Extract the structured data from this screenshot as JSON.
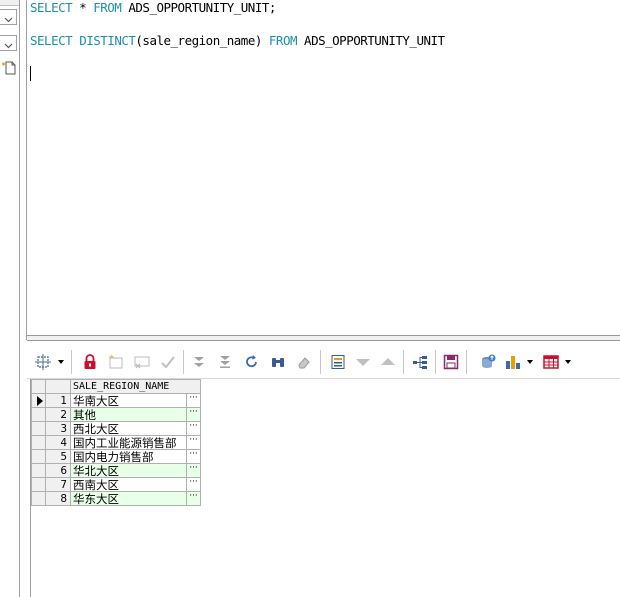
{
  "editor": {
    "line1": {
      "kw1": "SELECT",
      "mid1": " * ",
      "kw2": "FROM",
      "rest": " ADS_OPPORTUNITY_UNIT;"
    },
    "line2": {
      "kw1": "SELECT",
      "sp1": " ",
      "kw2": "DISTINCT",
      "mid": "(sale_region_name) ",
      "kw3": "FROM",
      "rest": " ADS_OPPORTUNITY_UNIT"
    }
  },
  "toolbar": {
    "buttons": [
      "query-tool-icon",
      "lock-icon",
      "insert-record-icon",
      "delete-record-icon",
      "post-edits-icon",
      "next-page-icon",
      "last-page-icon",
      "refresh-icon",
      "find-icon",
      "clear-icon",
      "single-record-view-icon",
      "move-down-icon",
      "move-up-icon",
      "query-plan-icon",
      "save-icon",
      "export-icon",
      "chart-icon",
      "table-view-icon"
    ]
  },
  "grid": {
    "column_header": "SALE_REGION_NAME",
    "ellipsis": "···",
    "rows": [
      {
        "num": "1",
        "value": "华南大区"
      },
      {
        "num": "2",
        "value": "其他"
      },
      {
        "num": "3",
        "value": "西北大区"
      },
      {
        "num": "4",
        "value": "国内工业能源销售部"
      },
      {
        "num": "5",
        "value": "国内电力销售部"
      },
      {
        "num": "6",
        "value": "华北大区"
      },
      {
        "num": "7",
        "value": "西南大区"
      },
      {
        "num": "8",
        "value": "华东大区"
      }
    ]
  },
  "colors": {
    "keyword": "#1f8fa8",
    "alt_row": "#e8ffe8",
    "accent_red": "#c8102e"
  }
}
